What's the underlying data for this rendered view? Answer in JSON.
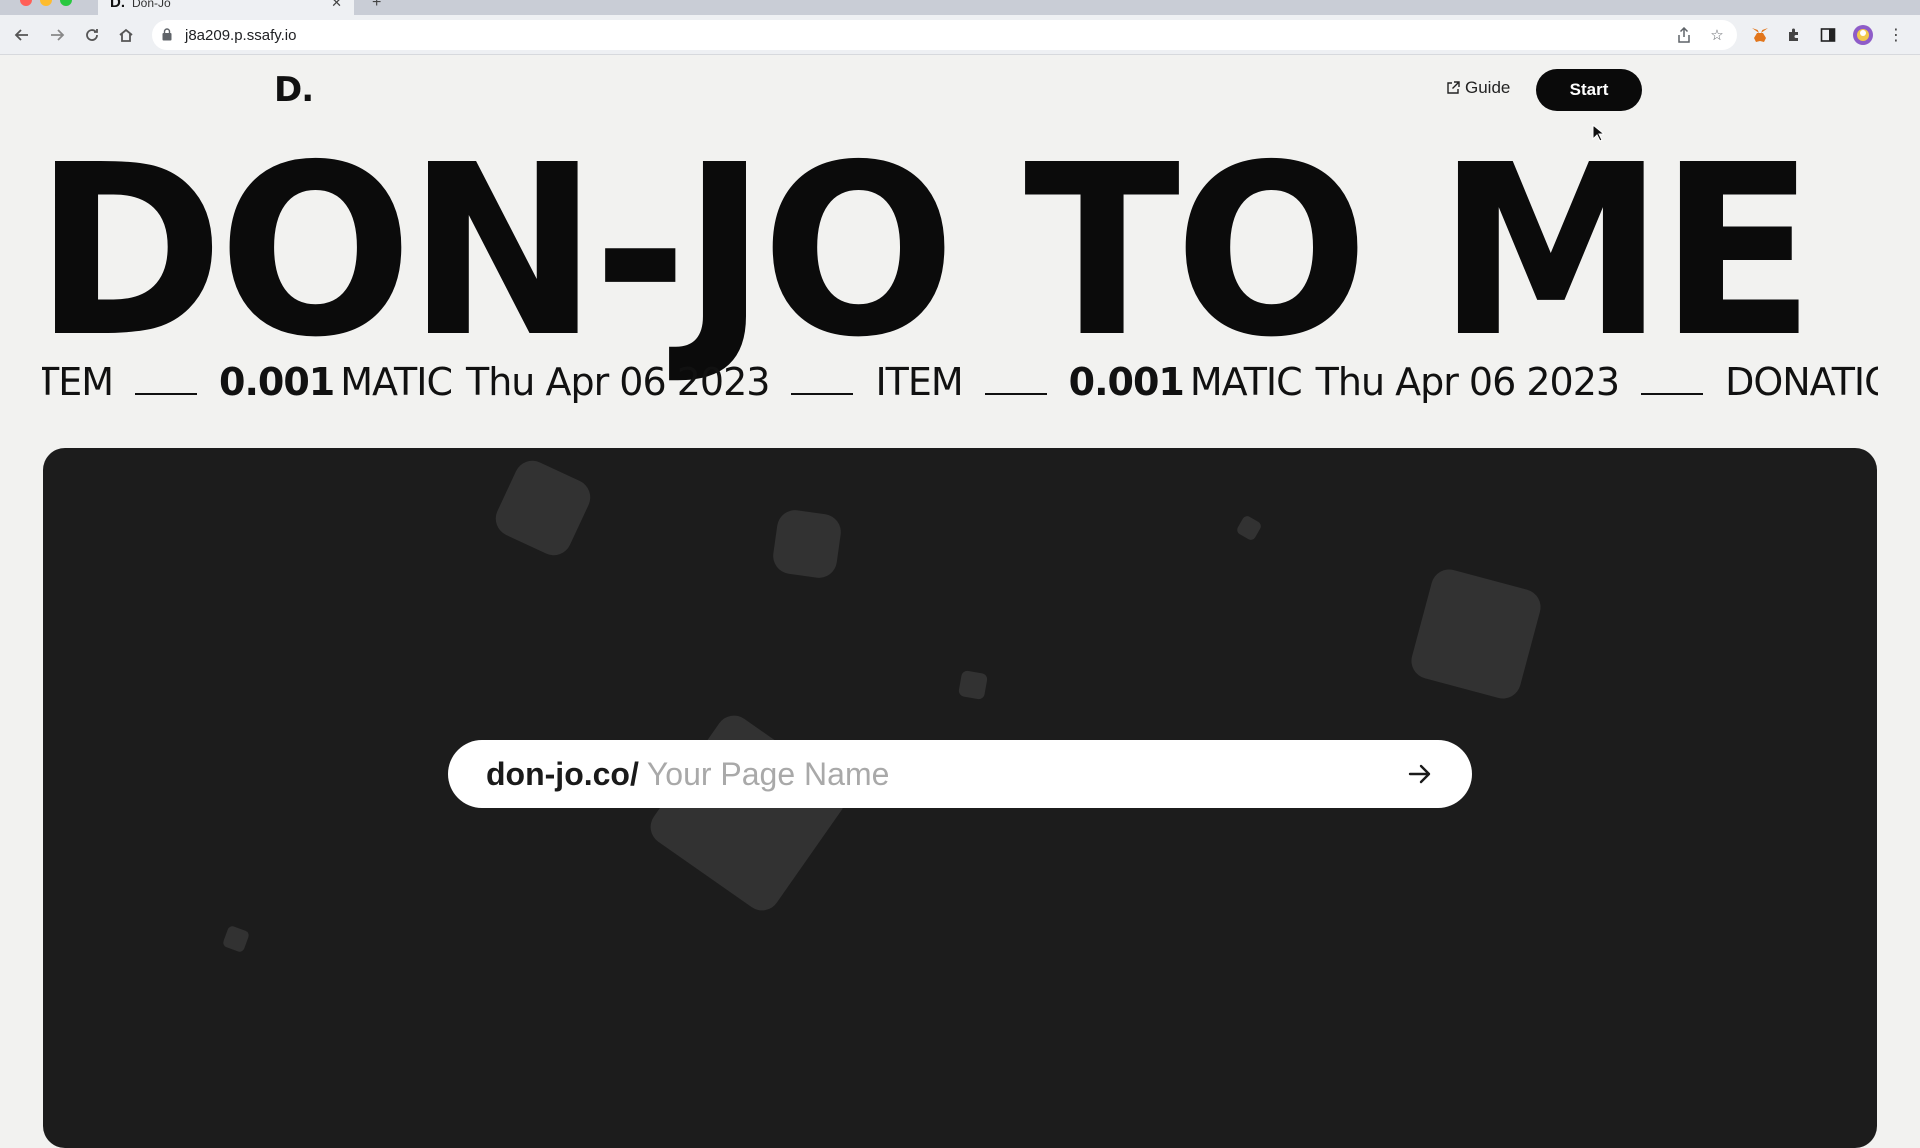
{
  "browser": {
    "tab_title": "Don-Jo",
    "tab_favicon": "D.",
    "url": "j8a209.p.ssafy.io",
    "icons": [
      "back-icon",
      "forward-icon",
      "reload-icon",
      "home-icon",
      "lock-icon",
      "share-icon",
      "star-icon",
      "metamask-icon",
      "puzzle-icon",
      "sidepanel-icon",
      "profile-avatar",
      "menu-icon"
    ]
  },
  "header": {
    "logo": "D.",
    "guide_label": "Guide",
    "start_label": "Start"
  },
  "hero": {
    "title": "DON-JO TO ME"
  },
  "ticker": {
    "items": [
      {
        "label": "TEM",
        "amount": "",
        "unit": "",
        "date": ""
      },
      {
        "label": "",
        "amount": "0.001",
        "unit": "MATIC",
        "date": "Thu Apr 06 2023"
      },
      {
        "label": "ITEM",
        "amount": "",
        "unit": "",
        "date": ""
      },
      {
        "label": "",
        "amount": "0.001",
        "unit": "MATIC",
        "date": "Thu Apr 06 2023"
      },
      {
        "label": "DONATION",
        "amount": "",
        "unit": "",
        "date": ""
      }
    ]
  },
  "main": {
    "url_prefix": "don-jo.co/",
    "page_name_placeholder": "Your Page Name",
    "page_name_value": ""
  },
  "colors": {
    "page_bg": "#f2f2f0",
    "card_bg": "#1c1c1c",
    "accent": "#0a0a0a",
    "text": "#111111",
    "placeholder": "#a9a9a9"
  }
}
